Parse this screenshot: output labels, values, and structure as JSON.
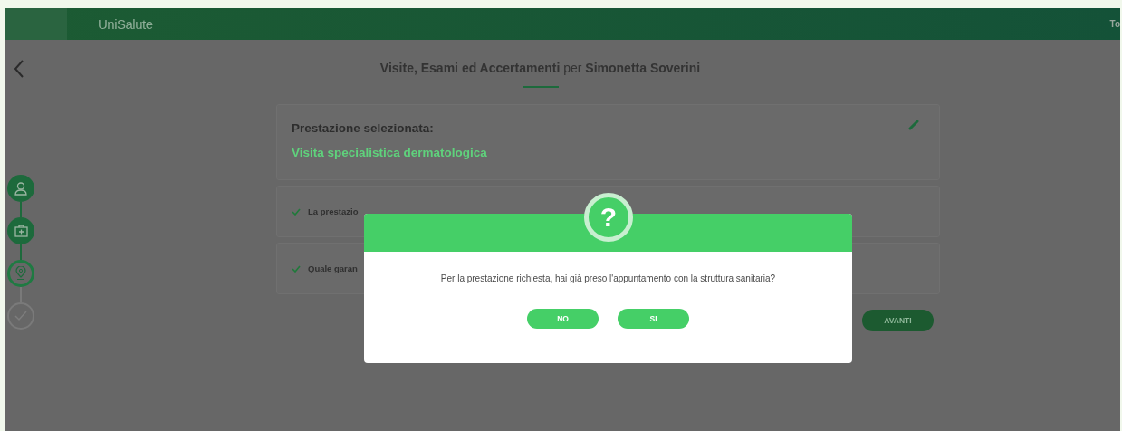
{
  "header": {
    "logo": "UniSalute",
    "user": "To"
  },
  "page_title": "**Visite, Esami ed Accertamenti** per **Simonetta Soverini**",
  "stepper": [
    {
      "completed": true,
      "selected": false
    },
    {
      "completed": true,
      "selected": false
    },
    {
      "completed": false,
      "selected": true
    },
    {
      "completed": false,
      "selected": false
    }
  ],
  "selected_service": {
    "label": "Prestazione selezionata:",
    "value": "Visita specialistica dermatologica"
  },
  "answers": [
    {
      "text": "La prestazio"
    },
    {
      "text": "Quale garan"
    }
  ],
  "next_button": "AVANTI",
  "dialog": {
    "icon_text": "?",
    "message": "Per la prestazione richiesta, hai già preso l'appuntamento con la struttura sanitaria?",
    "buttons": [
      "NO",
      "SI"
    ]
  }
}
